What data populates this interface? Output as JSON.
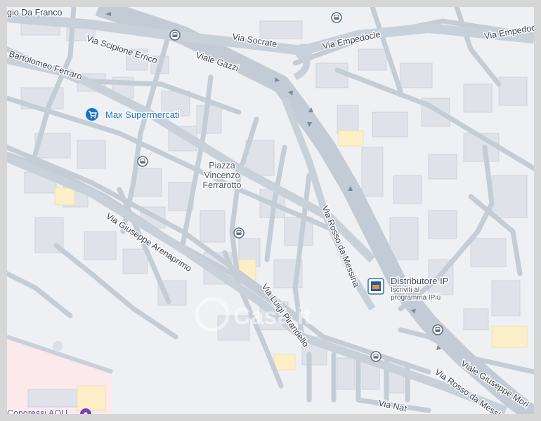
{
  "map": {
    "roads": [
      {
        "id": "via-socrate",
        "label": "Via Socrate"
      },
      {
        "id": "via-empedocle",
        "label": "Via Empedocle"
      },
      {
        "id": "via-empedocle-2",
        "label": "Via Empedocl"
      },
      {
        "id": "via-scipione-errico",
        "label": "Via Scipione Errico"
      },
      {
        "id": "viale-gazzi",
        "label": "Viale Gazzi"
      },
      {
        "id": "bartolomeo-ferraro",
        "label": "Bartolomeo Ferraro"
      },
      {
        "id": "via-giuseppe-arenaprimo",
        "label": "Via Giuseppe Arenaprimo"
      },
      {
        "id": "via-rosso-da-messina",
        "label": "Via Rosso da Messina"
      },
      {
        "id": "via-luigi-pirandello",
        "label": "Via Luigi Pirandello"
      },
      {
        "id": "viale-giuseppe-mori",
        "label": "Viale Giuseppe Mori"
      },
      {
        "id": "via-rosso-da-messi",
        "label": "Via Rosso da Messi"
      },
      {
        "id": "via-nat",
        "label": "Via Nat"
      },
      {
        "id": "gio-da-franco",
        "label": "gio Da Franco"
      }
    ],
    "places": {
      "piazza": [
        "Piazza",
        "Vincenzo",
        "Ferrarotto"
      ]
    },
    "pois": {
      "supermarket": {
        "name": "Max Supermercati",
        "icon": "shopping-cart-icon"
      },
      "fuel": {
        "name": "Distributore IP",
        "line1": "Iscriviti al",
        "line2": "programma IPiù",
        "icon": "fuel-station-icon"
      },
      "congress": {
        "name": "Congressi AOU",
        "icon": "venue-pin-icon"
      }
    },
    "watermark": "Casa.it",
    "colors": {
      "background": "#eef0f3",
      "main_road": "#c2cbd6",
      "minor_road": "#c8d0da",
      "building": "#dfe3e9",
      "poi_blue": "#1a73c8",
      "fuel_orange": "#e8912a",
      "congress_purple": "#7b3fb5",
      "hospital_area": "#fbe9ec"
    }
  }
}
